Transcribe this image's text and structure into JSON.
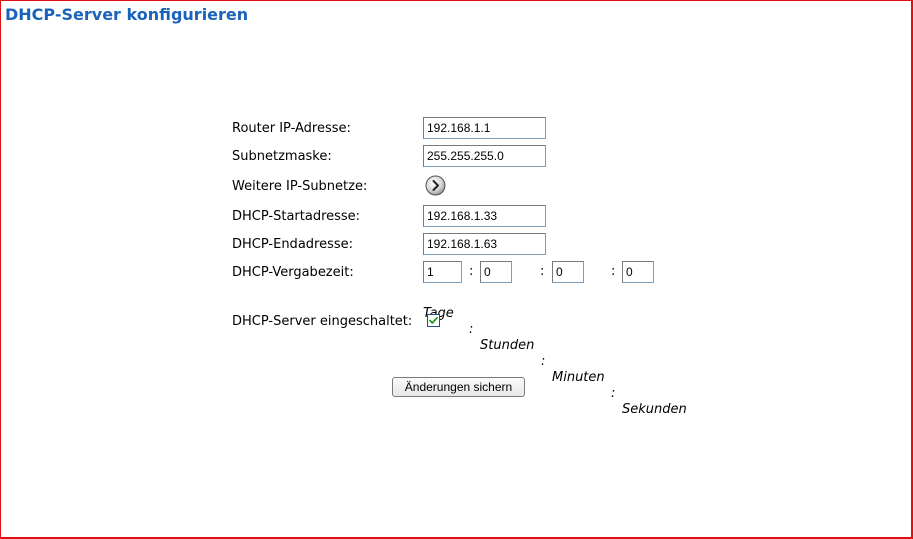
{
  "page": {
    "title": "DHCP-Server konfigurieren"
  },
  "form": {
    "router_ip": {
      "label": "Router IP-Adresse:",
      "value": "192.168.1.1"
    },
    "subnet_mask": {
      "label": "Subnetzmaske:",
      "value": "255.255.255.0"
    },
    "more_subnets": {
      "label": "Weitere IP-Subnetze:",
      "button_icon": "arrow-right-circle-icon"
    },
    "dhcp_start": {
      "label": "DHCP-Startadresse:",
      "value": "192.168.1.33"
    },
    "dhcp_end": {
      "label": "DHCP-Endadresse:",
      "value": "192.168.1.63"
    },
    "lease_time": {
      "label": "DHCP-Vergabezeit:",
      "days": "1",
      "hours": "0",
      "minutes": "0",
      "seconds": "0",
      "separator": ":",
      "unit_days": "Tage",
      "unit_hours": "Stunden",
      "unit_minutes": "Minuten",
      "unit_seconds": "Sekunden"
    },
    "server_enabled": {
      "label": "DHCP-Server eingeschaltet:",
      "checked": true
    },
    "save_label": "Änderungen sichern"
  },
  "colors": {
    "title": "#1a63b8",
    "frame": "#e01010"
  }
}
